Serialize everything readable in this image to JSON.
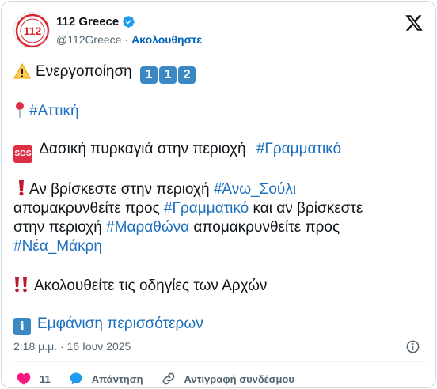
{
  "author": {
    "name": "112 Greece",
    "handle": "@112Greece",
    "separator": "·",
    "follow_label": "Ακολουθήστε",
    "avatar_text": "112"
  },
  "tweet": {
    "line1": "Ενεργοποίηση",
    "keycaps": [
      "1",
      "1",
      "2"
    ],
    "line2_tag": "#Αττική",
    "line3_text": "Δασική πυρκαγιά στην περιοχή",
    "line3_tag": "#Γραμματικό",
    "sos_label": "SOS",
    "line4_text": "Αν βρίσκεστε στην περιοχή",
    "line4_tag": "#Άνω_Σούλι",
    "line5_text_a": "απομακρυνθείτε προς",
    "line5_tag": "#Γραμματικό",
    "line5_text_b": "και αν βρίσκεστε",
    "line6_text_a": "στην περιοχή",
    "line6_tag": "#Μαραθώνα",
    "line6_text_b": "απομακρυνθείτε προς",
    "line7_tag": "#Νέα_Μάκρη",
    "line8_text": "Ακολουθείτε τις οδηγίες των Αρχών",
    "info_glyph": "i",
    "show_more": "Εμφάνιση περισσότερων"
  },
  "meta": {
    "timestamp": "2:18 μ.μ. · 16 Ιουν 2025"
  },
  "actions": {
    "likes": "11",
    "reply_label": "Απάντηση",
    "copy_link_label": "Αντιγραφή συνδέσμου"
  },
  "colors": {
    "link": "#1d6fbe",
    "follow": "#0063b8",
    "like": "#f91880",
    "verified": "#1d9bf0",
    "keycap": "#3b88c3",
    "sos": "#dd2e44"
  },
  "icons": [
    "verified-badge-icon",
    "x-logo-icon",
    "warning-icon",
    "round-pushpin-icon",
    "sos-icon",
    "exclamation-icon",
    "double-exclamation-icon",
    "information-icon",
    "info-circle-icon",
    "heart-icon",
    "reply-bubble-icon",
    "link-icon"
  ]
}
